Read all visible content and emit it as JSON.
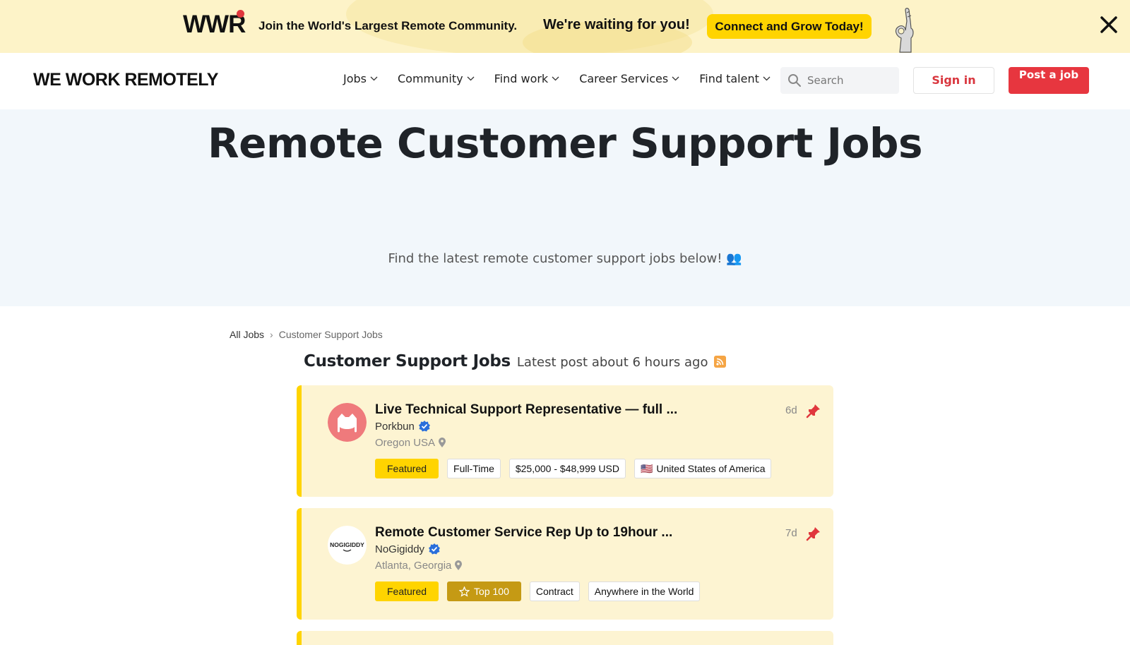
{
  "promo": {
    "logo": "WWR",
    "join_text": "Join the World's Largest Remote Community.",
    "waiting_text": "We're waiting for you!",
    "cta_label": "Connect and Grow Today!",
    "accent": "#ffd400",
    "dot_color": "#e0373d"
  },
  "nav": {
    "brand": "WE WORK REMOTELY",
    "menu": [
      {
        "label": "Jobs"
      },
      {
        "label": "Community"
      },
      {
        "label": "Find work"
      },
      {
        "label": "Career Services"
      },
      {
        "label": "Find talent"
      }
    ],
    "search_placeholder": "Search",
    "signin_label": "Sign in",
    "post_label": "Post a job",
    "brand_red": "#e7363f"
  },
  "hero": {
    "title": "Remote Customer Support Jobs",
    "subtitle": "Find the latest remote customer support jobs below! 👥"
  },
  "breadcrumb": {
    "root": "All Jobs",
    "separator": "›",
    "current": "Customer Support Jobs"
  },
  "section": {
    "title": "Customer Support Jobs",
    "latest": "Latest post about 6 hours ago",
    "rss_icon": "rss-icon"
  },
  "jobs": [
    {
      "title": "Live Technical Support Representative — full ...",
      "company": "Porkbun",
      "location": "Oregon USA",
      "age": "6d",
      "logo_icon": "porkbun-logo",
      "tags": {
        "featured": "Featured",
        "type": "Full-Time",
        "salary": "$25,000 - $48,999 USD",
        "region_flag": "🇺🇸",
        "region": "United States of America"
      }
    },
    {
      "title": "Remote Customer Service Rep Up to 19hour ...",
      "company": "NoGigiddy",
      "location": "Atlanta, Georgia",
      "age": "7d",
      "logo_icon": "nogigiddy-logo",
      "logo_text": "NOGIGIDDY",
      "tags": {
        "featured": "Featured",
        "top": "Top 100",
        "type": "Contract",
        "region": "Anywhere in the World"
      }
    }
  ]
}
